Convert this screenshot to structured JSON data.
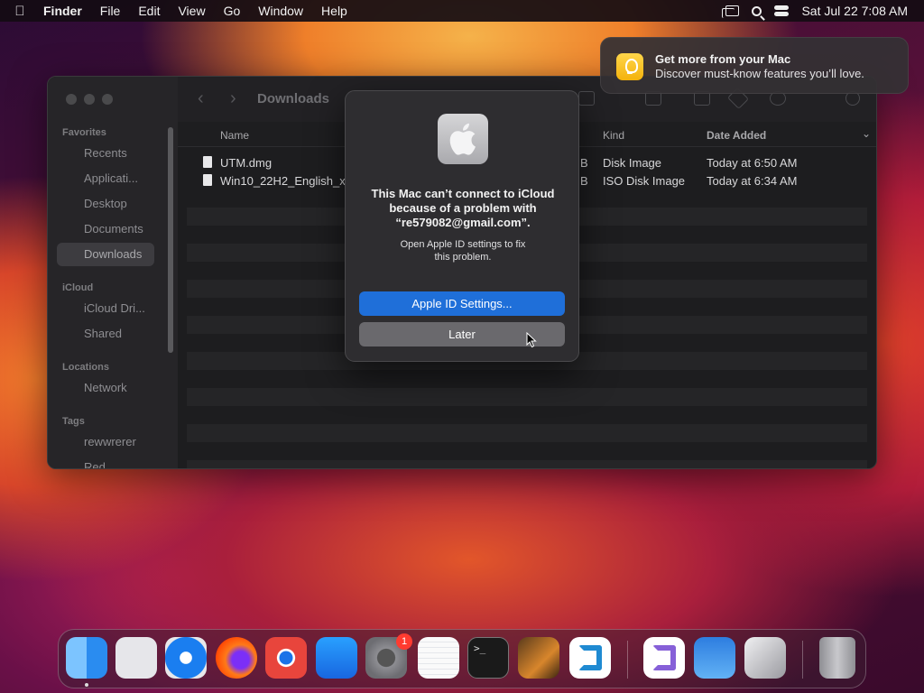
{
  "menubar": {
    "app_name": "Finder",
    "items": [
      "File",
      "Edit",
      "View",
      "Go",
      "Window",
      "Help"
    ],
    "datetime": "Sat Jul 22  7:08 AM"
  },
  "finder": {
    "title": "Downloads",
    "sidebar": {
      "favorites_heading": "Favorites",
      "favorites": [
        "Recents",
        "Applicati...",
        "Desktop",
        "Documents",
        "Downloads"
      ],
      "selected": "Downloads",
      "icloud_heading": "iCloud",
      "icloud": [
        "iCloud Dri...",
        "Shared"
      ],
      "locations_heading": "Locations",
      "locations": [
        "Network"
      ],
      "tags_heading": "Tags",
      "tags": [
        "rewwrerer",
        "Red"
      ]
    },
    "columns": {
      "name": "Name",
      "kind": "Kind",
      "date_added": "Date Added"
    },
    "files": [
      {
        "name": "UTM.dmg",
        "size_tail": "B",
        "kind": "Disk Image",
        "date_added": "Today at 6:50 AM"
      },
      {
        "name": "Win10_22H2_English_x",
        "size_tail": "B",
        "kind": "ISO Disk Image",
        "date_added": "Today at 6:34 AM"
      }
    ]
  },
  "notification": {
    "title": "Get more from your Mac",
    "body": "Discover must-know features you’ll love.",
    "icon": "lightbulb-icon"
  },
  "alert": {
    "title_line1": "This Mac can’t connect to iCloud",
    "title_line2": "because of a problem with",
    "title_line3": "“re579082@gmail.com”.",
    "message_line1": "Open Apple ID settings to fix",
    "message_line2": "this problem.",
    "primary_button": "Apple ID Settings...",
    "secondary_button": "Later"
  },
  "dock": {
    "apps": [
      "Finder",
      "Launchpad",
      "Safari",
      "Firefox",
      "Chrome",
      "App Store",
      "System Settings",
      "TextEdit",
      "Terminal",
      "GarageBand",
      "Visual Studio Code",
      "Visual Studio",
      "Weather",
      "Boot Camp Assistant",
      "Trash"
    ],
    "system_settings_badge": "1",
    "colors": {
      "finder": "#2a8cf0",
      "safari": "#1a7ef0",
      "chrome": "#e8453c",
      "vscode": "#1f8ad2",
      "terminal": "#1a1a1a"
    }
  },
  "colors": {
    "accent": "#1f6fd9",
    "alert_bg": "#2e2d30",
    "secondary_button": "#6a696d"
  }
}
